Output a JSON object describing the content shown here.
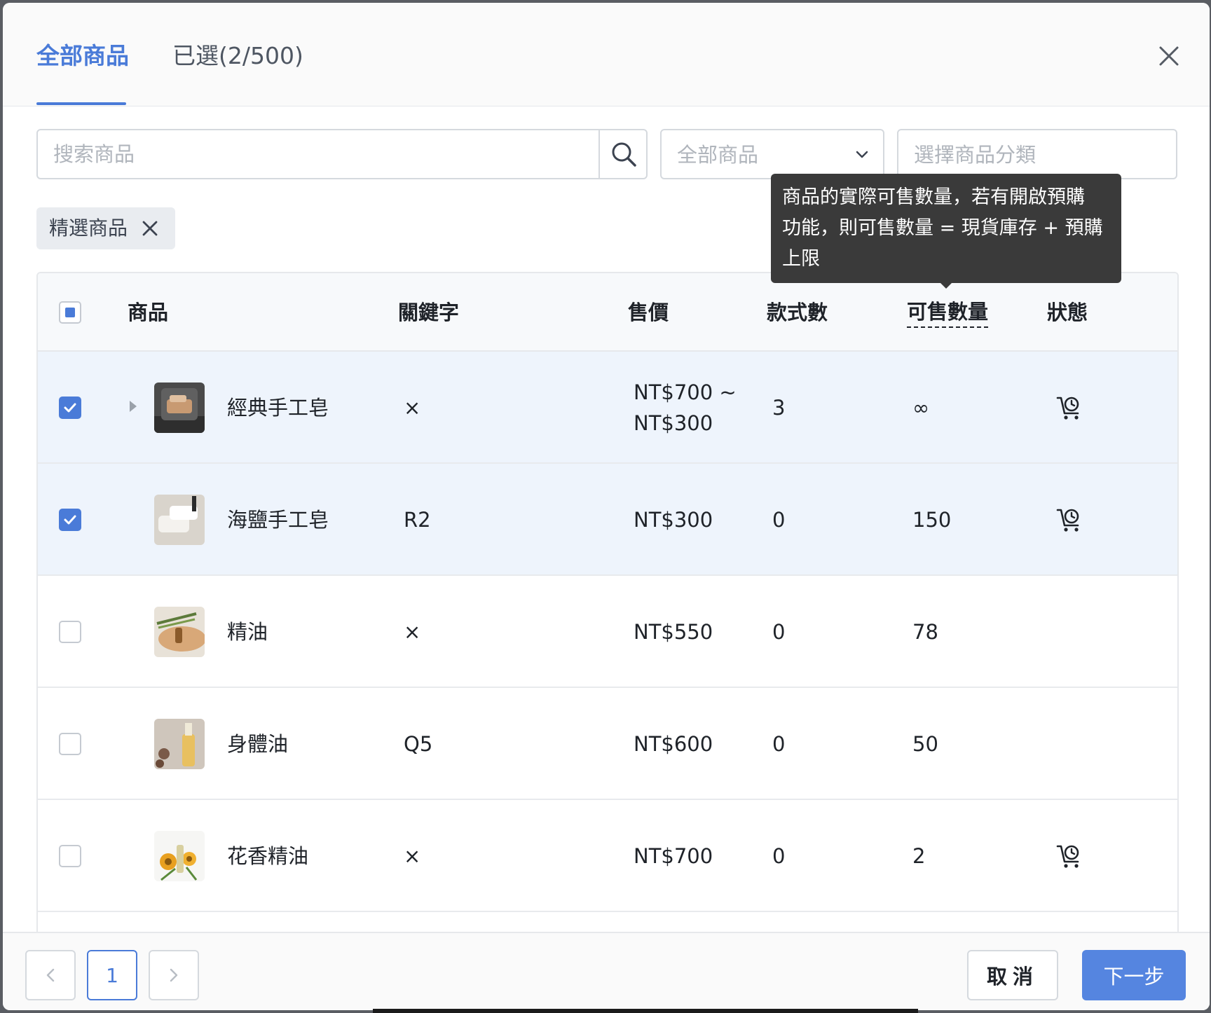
{
  "tabs": [
    {
      "label": "全部商品",
      "active": true
    },
    {
      "label": "已選(2/500)",
      "active": false
    }
  ],
  "filters": {
    "search_placeholder": "搜索商品",
    "product_select_placeholder": "全部商品",
    "category_placeholder": "選擇商品分類"
  },
  "active_tag": "精選商品",
  "table": {
    "headers": {
      "product": "商品",
      "keyword": "關鍵字",
      "price": "售價",
      "variants": "款式數",
      "stock": "可售數量",
      "status": "狀態"
    },
    "rows": [
      {
        "name": "經典手工皂",
        "keyword": "×",
        "price": [
          "NT$700 ~",
          "NT$300"
        ],
        "variants": "3",
        "stock": "∞",
        "selected": true,
        "expandable": true,
        "status_icon": "cart-clock-icon"
      },
      {
        "name": "海鹽手工皂",
        "keyword": "R2",
        "price": [
          "NT$300"
        ],
        "variants": "0",
        "stock": "150",
        "selected": true,
        "expandable": false,
        "status_icon": "cart-clock-icon"
      },
      {
        "name": "精油",
        "keyword": "×",
        "price": [
          "NT$550"
        ],
        "variants": "0",
        "stock": "78",
        "selected": false,
        "expandable": false,
        "status_icon": ""
      },
      {
        "name": "身體油",
        "keyword": "Q5",
        "price": [
          "NT$600"
        ],
        "variants": "0",
        "stock": "50",
        "selected": false,
        "expandable": false,
        "status_icon": ""
      },
      {
        "name": "花香精油",
        "keyword": "×",
        "price": [
          "NT$700"
        ],
        "variants": "0",
        "stock": "2",
        "selected": false,
        "expandable": false,
        "status_icon": "cart-clock-icon"
      }
    ]
  },
  "tooltip": {
    "lines": [
      "商品的實際可售數量，若有開啟預購",
      "功能，則可售數量 = 現貨庫存 + 預購",
      "上限"
    ]
  },
  "pagination": {
    "current_page": "1"
  },
  "footer": {
    "cancel_label": "取消",
    "next_label": "下一步"
  },
  "colors": {
    "accent": "#4a7bd8",
    "primary_button": "#5585e0",
    "selected_row": "#eef4fc",
    "tooltip_bg": "#3a3a3a"
  }
}
